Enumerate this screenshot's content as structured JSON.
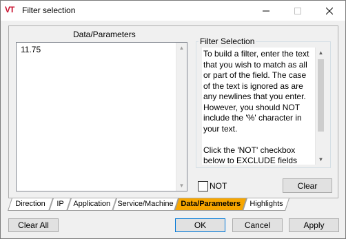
{
  "window": {
    "title": "Filter selection",
    "icon": "VT"
  },
  "panel": {
    "label": "Data/Parameters",
    "list_items": [
      "11.75"
    ]
  },
  "filter_selection": {
    "label": "Filter Selection",
    "paragraph1": "To build a filter, enter the text that you wish to match as all or part of the field. The case of the text is ignored as are any newlines that you enter. However, you should NOT include the '%' character in your text.",
    "paragraph2": "Click the 'NOT' checkbox below to EXCLUDE fields"
  },
  "not_checkbox": {
    "label": "NOT",
    "checked": false
  },
  "clear_button": "Clear",
  "tabs": [
    {
      "label": "Direction"
    },
    {
      "label": "IP"
    },
    {
      "label": "Application"
    },
    {
      "label": "Service/Machine"
    },
    {
      "label": "Data/Parameters",
      "active": true
    },
    {
      "label": "Highlights"
    }
  ],
  "buttons": {
    "clear_all": "Clear All",
    "ok": "OK",
    "cancel": "Cancel",
    "apply": "Apply"
  },
  "colors": {
    "active_tab": "#f7a600",
    "icon": "#c8102e",
    "default_border": "#0078d7"
  }
}
